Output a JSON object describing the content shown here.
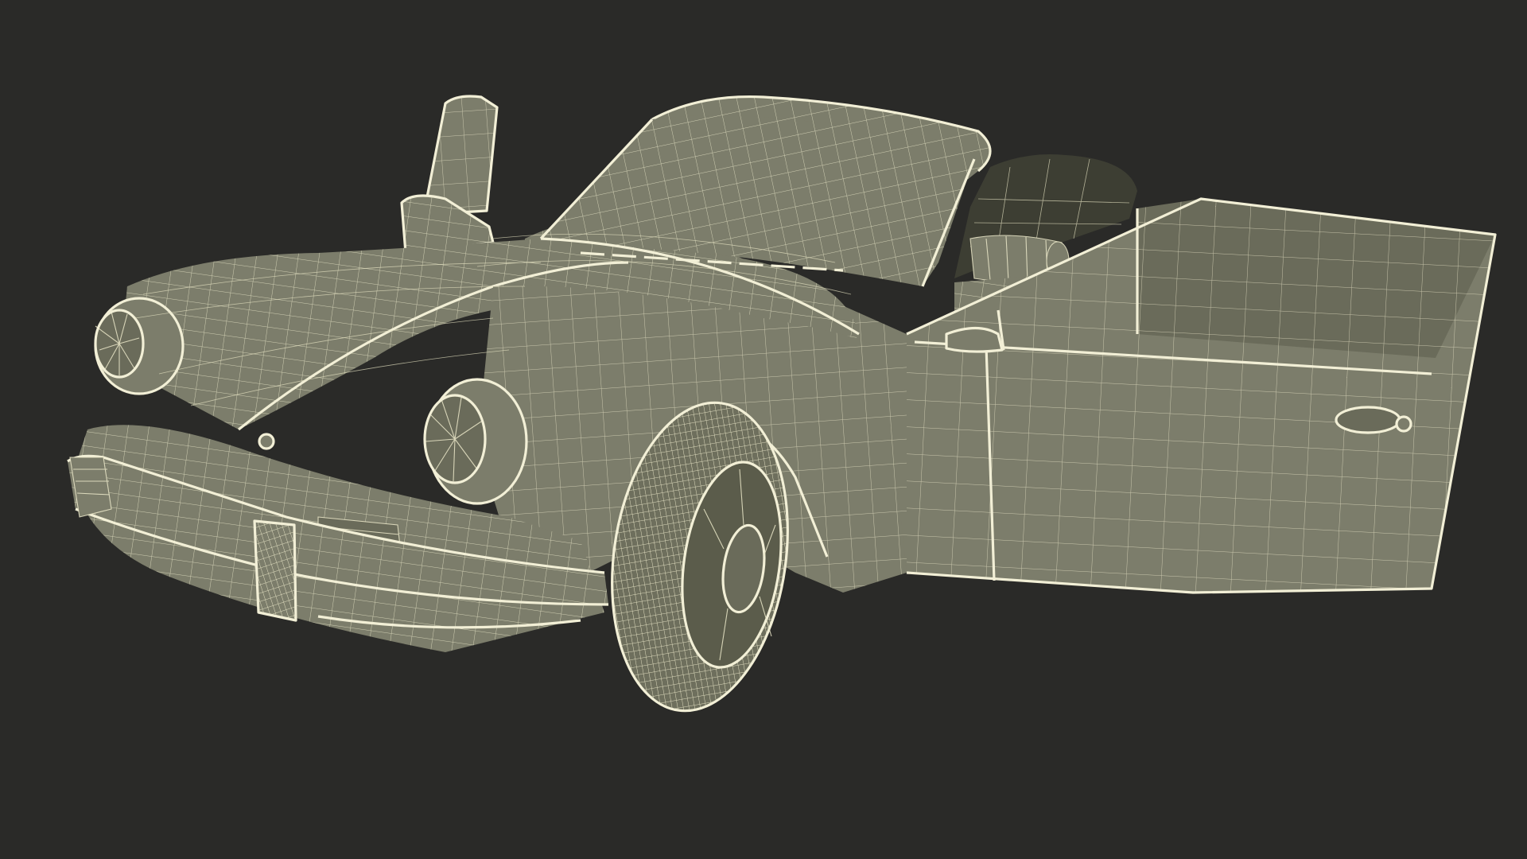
{
  "scene": {
    "subject": "car-wireframe-model",
    "background_color": "#2a2a28",
    "body_color": "#7c7d6b",
    "wire_color": "#ebe8c9",
    "highlight_edge_color": "#f2efd6",
    "interior_color": "#3d3e33"
  },
  "parts": {
    "hood": "hood",
    "roof": "roof",
    "windshield": "windshield",
    "left_headlight": "headlight",
    "right_headlight": "headlight",
    "front_bumper": "bumper",
    "door": "door",
    "front_wheel": "wheel",
    "trunk_lid": "lid",
    "mirror": "mirror"
  }
}
